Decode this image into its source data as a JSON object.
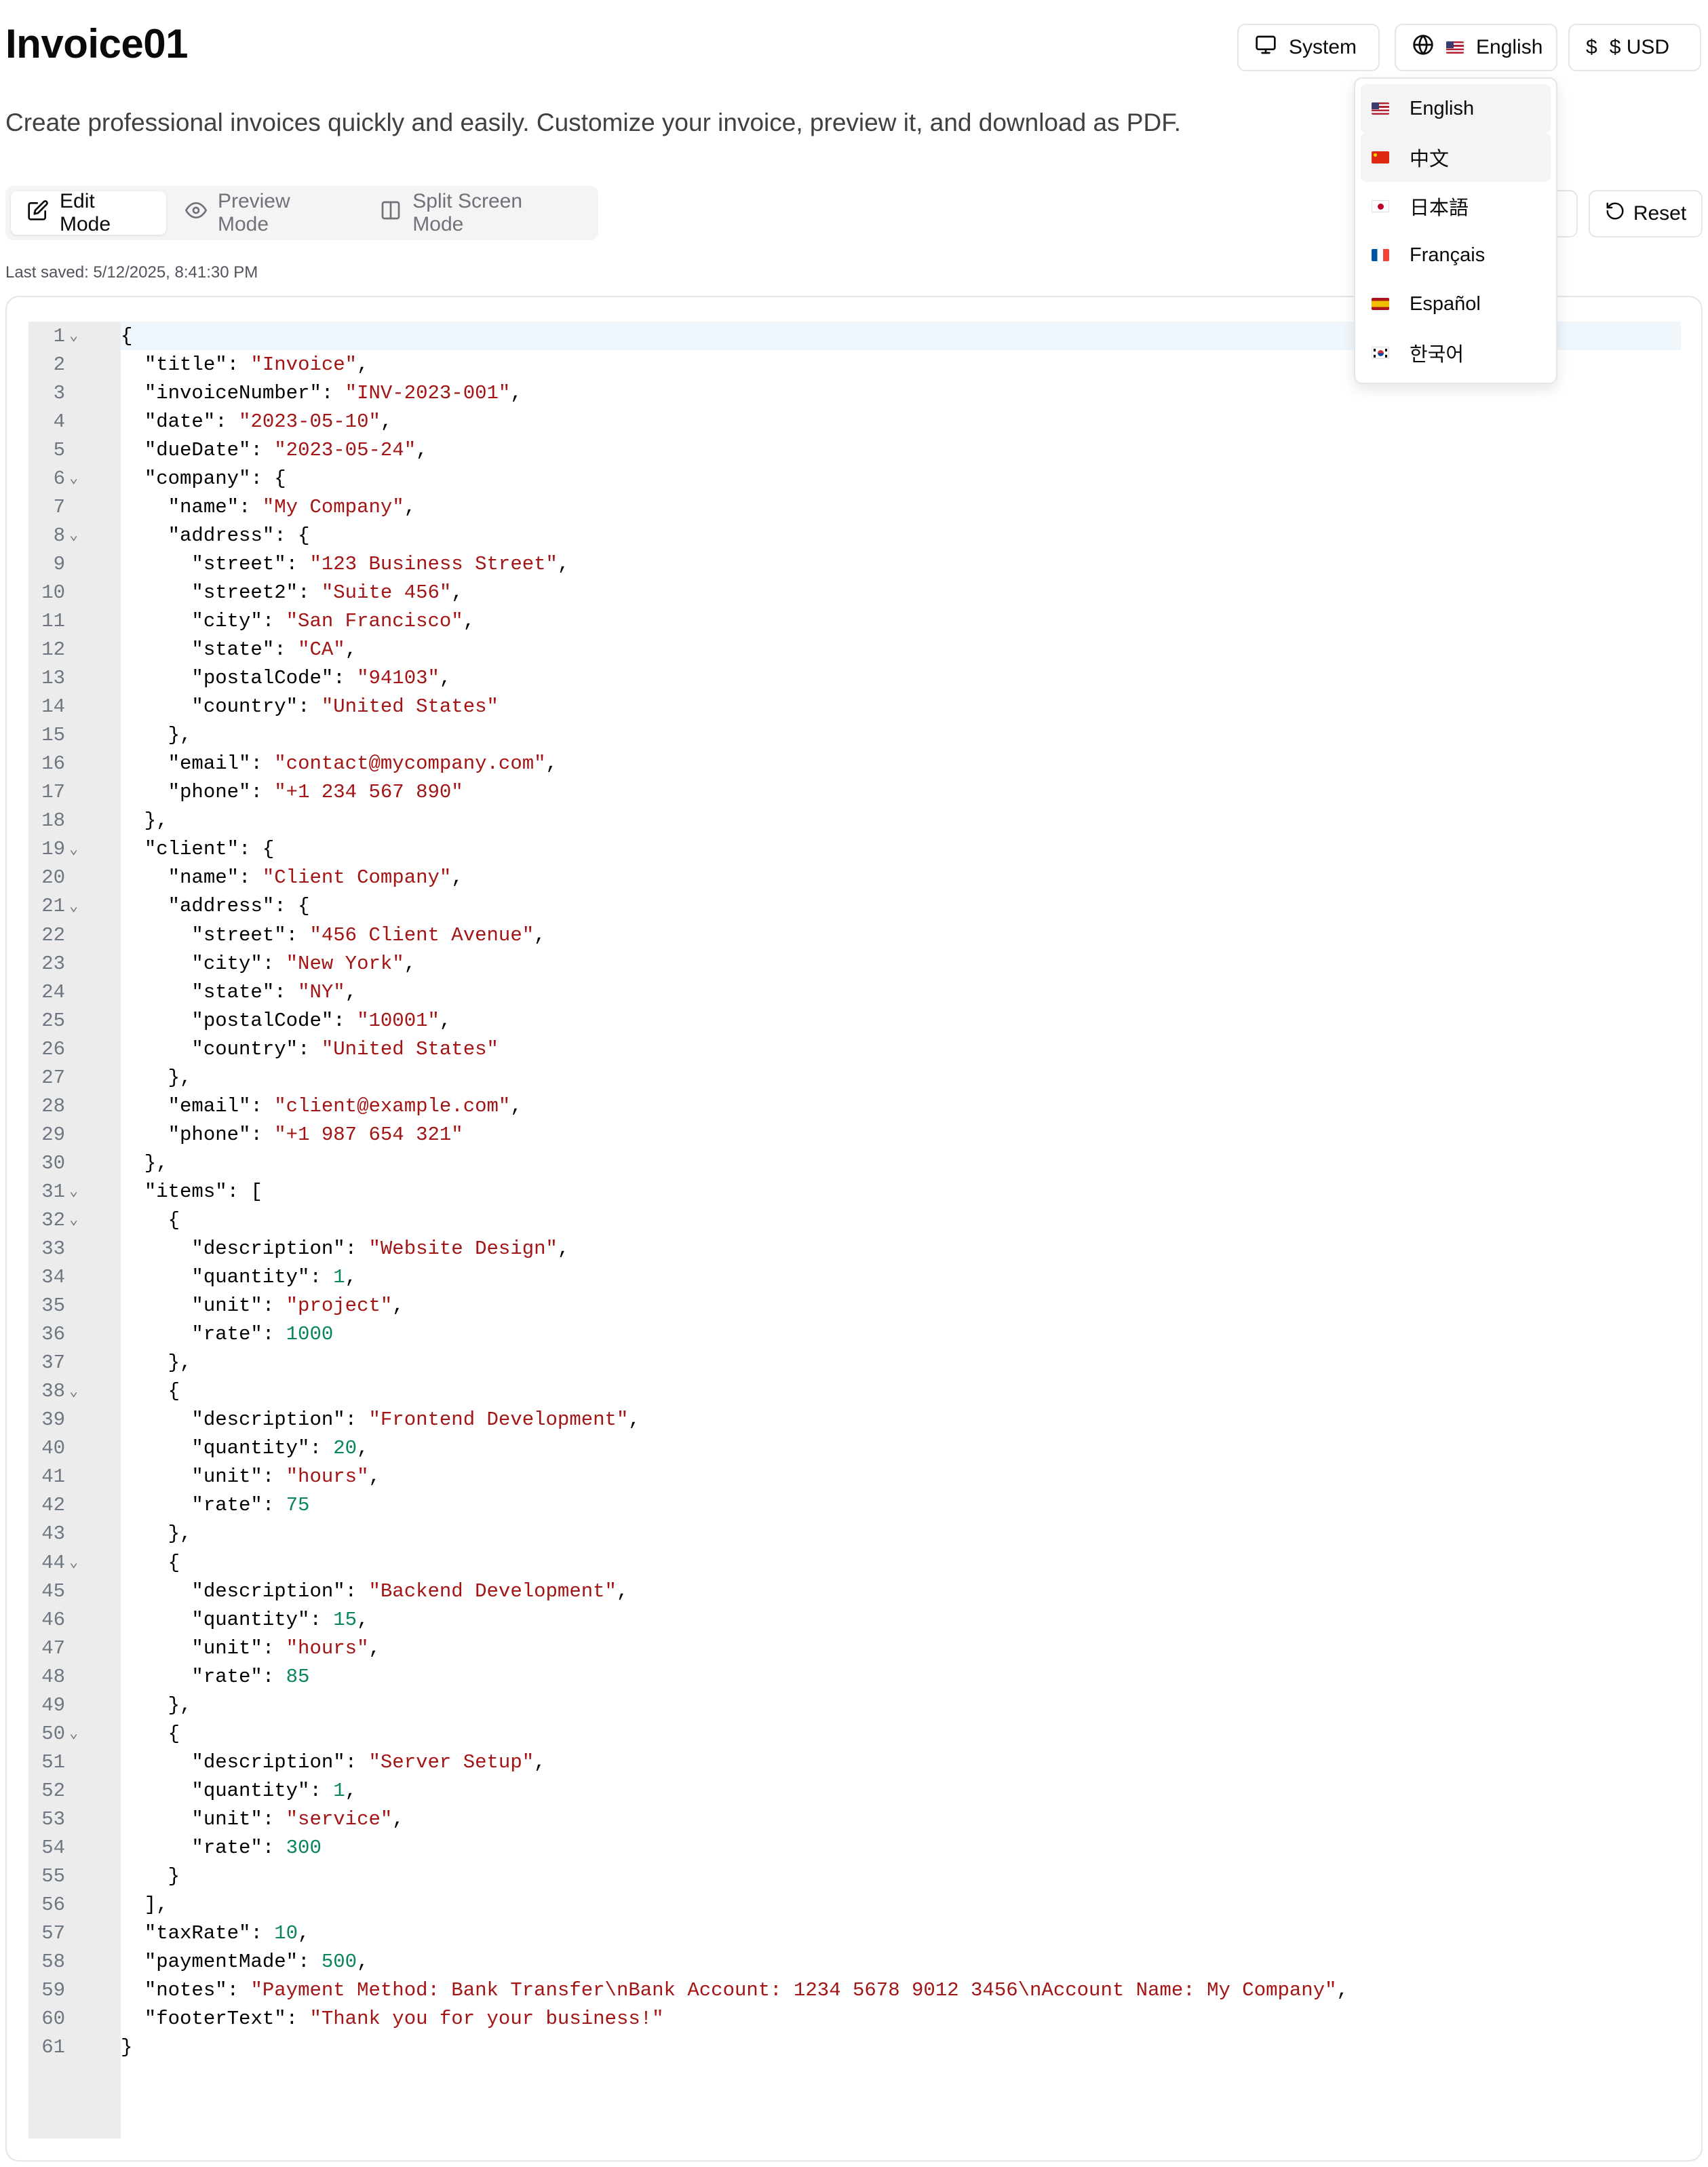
{
  "header": {
    "title": "Invoice01",
    "subtitle": "Create professional invoices quickly and easily. Customize your invoice, preview it, and download as PDF."
  },
  "toolbar": {
    "theme_label": "System",
    "language_label": "English",
    "currency_symbol": "$",
    "currency_label": "$ USD",
    "reset_label": "Reset"
  },
  "modes": [
    {
      "label": "Edit Mode",
      "active": true,
      "icon": "edit-icon"
    },
    {
      "label": "Preview Mode",
      "active": false,
      "icon": "eye-icon"
    },
    {
      "label": "Split Screen Mode",
      "active": false,
      "icon": "columns-icon"
    }
  ],
  "last_saved": "Last saved: 5/12/2025, 8:41:30 PM",
  "language_menu": {
    "items": [
      {
        "label": "English",
        "flag": "flag-us",
        "highlighted": true
      },
      {
        "label": "中文",
        "flag": "flag-cn",
        "highlighted": true
      },
      {
        "label": "日本語",
        "flag": "flag-jp",
        "highlighted": false
      },
      {
        "label": "Français",
        "flag": "flag-fr",
        "highlighted": false
      },
      {
        "label": "Español",
        "flag": "flag-es",
        "highlighted": false
      },
      {
        "label": "한국어",
        "flag": "flag-kr",
        "highlighted": false
      }
    ]
  },
  "editor": {
    "colors": {
      "string": "#a31515",
      "number": "#098658",
      "active_line": "#f0f7fc",
      "gutter": "#ececec"
    },
    "lines": [
      "{",
      "  \"title\": \"Invoice\",",
      "  \"invoiceNumber\": \"INV-2023-001\",",
      "  \"date\": \"2023-05-10\",",
      "  \"dueDate\": \"2023-05-24\",",
      "  \"company\": {",
      "    \"name\": \"My Company\",",
      "    \"address\": {",
      "      \"street\": \"123 Business Street\",",
      "      \"street2\": \"Suite 456\",",
      "      \"city\": \"San Francisco\",",
      "      \"state\": \"CA\",",
      "      \"postalCode\": \"94103\",",
      "      \"country\": \"United States\"",
      "    },",
      "    \"email\": \"contact@mycompany.com\",",
      "    \"phone\": \"+1 234 567 890\"",
      "  },",
      "  \"client\": {",
      "    \"name\": \"Client Company\",",
      "    \"address\": {",
      "      \"street\": \"456 Client Avenue\",",
      "      \"city\": \"New York\",",
      "      \"state\": \"NY\",",
      "      \"postalCode\": \"10001\",",
      "      \"country\": \"United States\"",
      "    },",
      "    \"email\": \"client@example.com\",",
      "    \"phone\": \"+1 987 654 321\"",
      "  },",
      "  \"items\": [",
      "    {",
      "      \"description\": \"Website Design\",",
      "      \"quantity\": 1,",
      "      \"unit\": \"project\",",
      "      \"rate\": 1000",
      "    },",
      "    {",
      "      \"description\": \"Frontend Development\",",
      "      \"quantity\": 20,",
      "      \"unit\": \"hours\",",
      "      \"rate\": 75",
      "    },",
      "    {",
      "      \"description\": \"Backend Development\",",
      "      \"quantity\": 15,",
      "      \"unit\": \"hours\",",
      "      \"rate\": 85",
      "    },",
      "    {",
      "      \"description\": \"Server Setup\",",
      "      \"quantity\": 1,",
      "      \"unit\": \"service\",",
      "      \"rate\": 300",
      "    }",
      "  ],",
      "  \"taxRate\": 10,",
      "  \"paymentMade\": 500,",
      "  \"notes\": \"Payment Method: Bank Transfer\\nBank Account: 1234 5678 9012 3456\\nAccount Name: My Company\",",
      "  \"footerText\": \"Thank you for your business!\"",
      "}"
    ],
    "foldable_lines": [
      1,
      6,
      8,
      19,
      21,
      31,
      32,
      38,
      44,
      50
    ]
  }
}
